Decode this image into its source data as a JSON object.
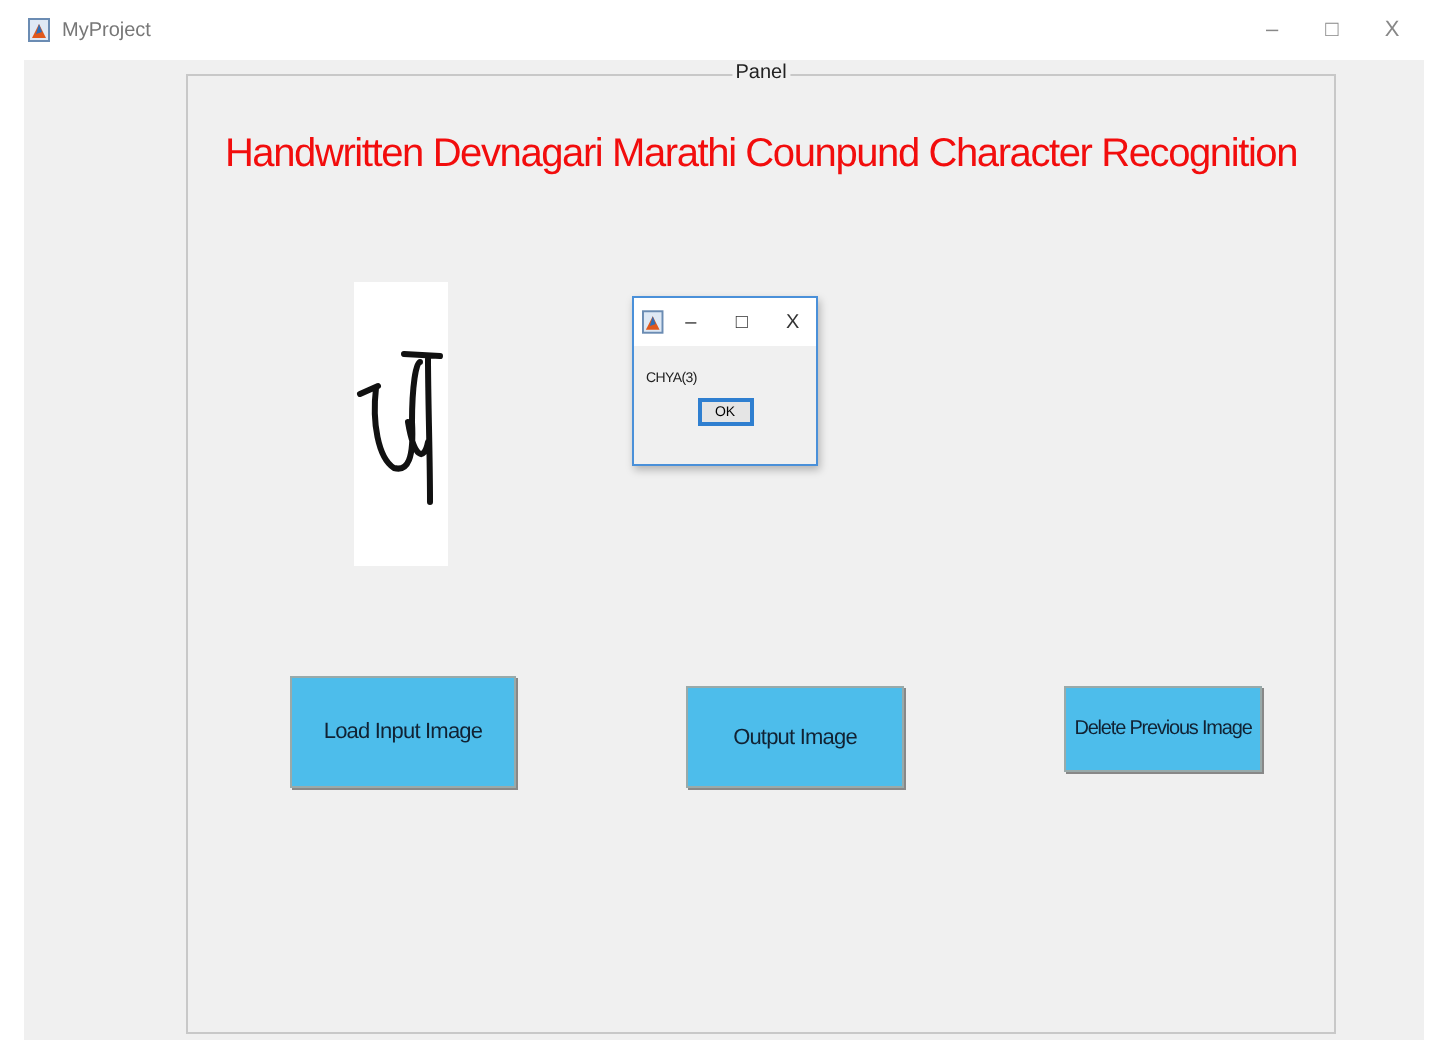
{
  "window": {
    "title": "MyProject",
    "controls": [
      "–",
      "□",
      "X"
    ]
  },
  "panel": {
    "label": "Panel",
    "heading": "Handwritten Devnagari Marathi Counpund Character Recognition"
  },
  "buttons": [
    "Load Input Image",
    "Output Image",
    "Delete Previous Image"
  ],
  "dialog": {
    "controls": [
      "–",
      "□",
      "X"
    ],
    "message": "CHYA(3)",
    "button": "OK"
  }
}
